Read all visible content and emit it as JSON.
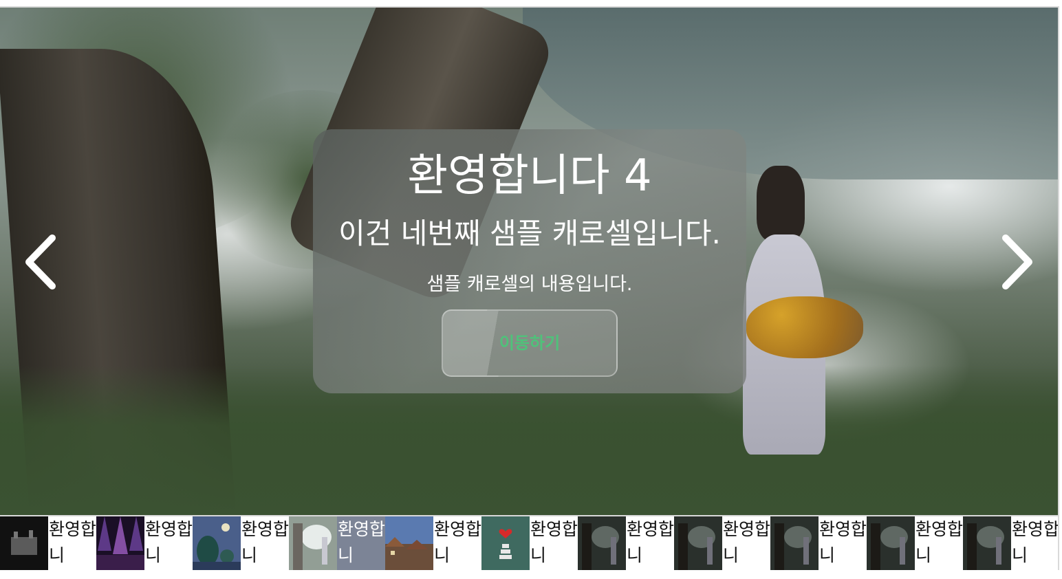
{
  "slide": {
    "title": "환영합니다 4",
    "subtitle": "이건 네번째 샘플 캐로셀입니다.",
    "description": "샘플 캐로셀의 내용입니다.",
    "button_label": "이동하기"
  },
  "controls": {
    "prev_icon": "chevron-left-icon",
    "next_icon": "chevron-right-icon"
  },
  "thumbnails": [
    {
      "label": "환영합니",
      "image": "castle-night-image",
      "active": false
    },
    {
      "label": "환영합니",
      "image": "concert-stage-image",
      "active": false
    },
    {
      "label": "환영합니",
      "image": "night-trees-image",
      "active": false
    },
    {
      "label": "환영합니",
      "image": "forest-woman-image",
      "active": true
    },
    {
      "label": "환영합니",
      "image": "town-rooftops-image",
      "active": false
    },
    {
      "label": "환영합니",
      "image": "heart-tower-image",
      "active": false
    },
    {
      "label": "환영합니",
      "image": "forest-woman-dark-image",
      "active": false
    },
    {
      "label": "환영합니",
      "image": "forest-woman-dark-image",
      "active": false
    },
    {
      "label": "환영합니",
      "image": "forest-woman-dark-image",
      "active": false
    },
    {
      "label": "환영합니",
      "image": "forest-woman-dark-image",
      "active": false
    },
    {
      "label": "환영합니",
      "image": "forest-woman-dark-image",
      "active": false
    }
  ],
  "colors": {
    "button_text": "#4fc27a",
    "active_thumb": "#7c8496"
  }
}
